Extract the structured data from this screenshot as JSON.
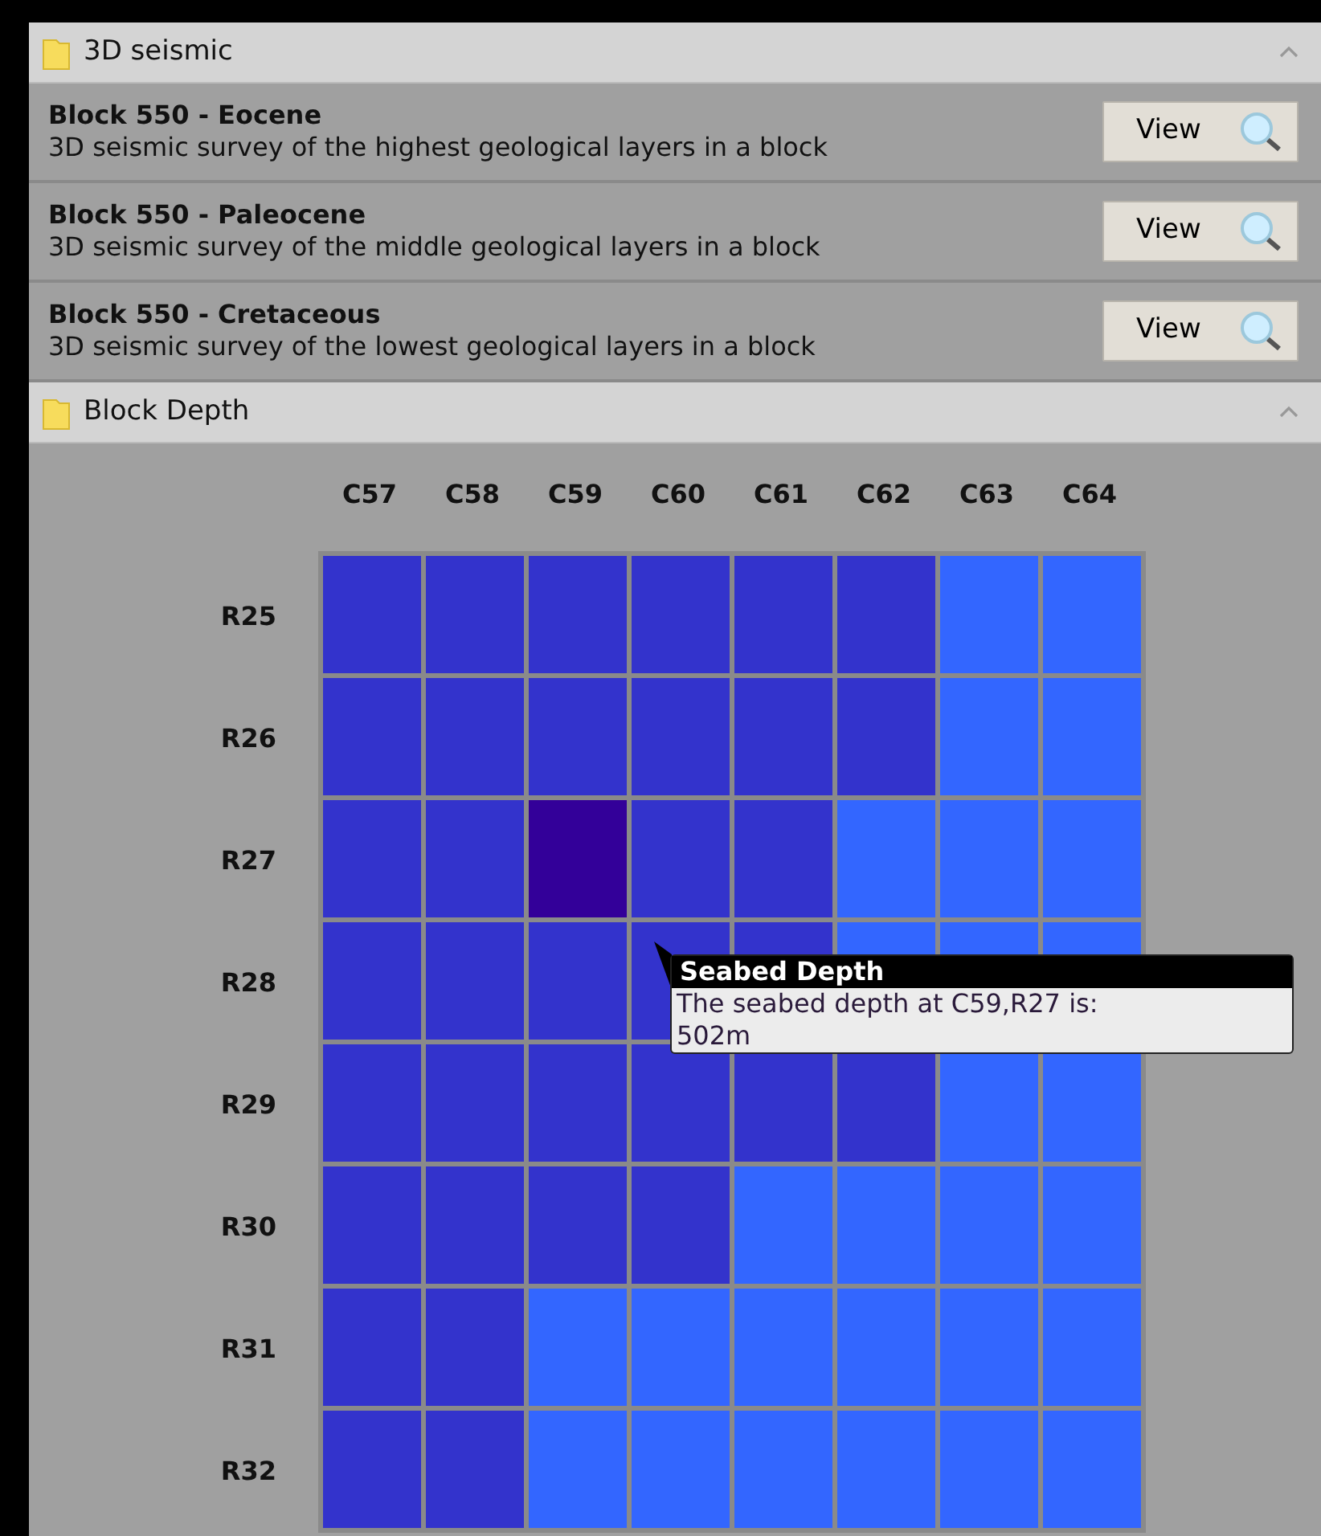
{
  "sections": [
    {
      "title": "3D seismic",
      "expanded": true,
      "items": [
        {
          "title": "Block 550 - Eocene",
          "description": "3D seismic survey of the highest geological layers in a block",
          "button": "View"
        },
        {
          "title": "Block 550 - Paleocene",
          "description": "3D seismic survey of the middle geological layers in a block",
          "button": "View"
        },
        {
          "title": "Block 550 - Cretaceous",
          "description": "3D seismic survey of the lowest geological layers in a block",
          "button": "View"
        }
      ]
    },
    {
      "title": "Block Depth",
      "expanded": true,
      "heatmap": {
        "columns": [
          "C57",
          "C58",
          "C59",
          "C60",
          "C61",
          "C62",
          "C63",
          "C64"
        ],
        "rows": [
          {
            "label": "R25",
            "cells": [
              {
                "color": "#3333cc"
              },
              {
                "color": "#3333cc"
              },
              {
                "color": "#3333cc"
              },
              {
                "color": "#3333cc"
              },
              {
                "color": "#3333cc"
              },
              {
                "color": "#3333cc"
              },
              {
                "color": "#3366ff"
              },
              {
                "color": "#3366ff"
              }
            ]
          },
          {
            "label": "R26",
            "cells": [
              {
                "color": "#3333cc"
              },
              {
                "color": "#3333cc"
              },
              {
                "color": "#3333cc"
              },
              {
                "color": "#3333cc"
              },
              {
                "color": "#3333cc"
              },
              {
                "color": "#3333cc"
              },
              {
                "color": "#3366ff"
              },
              {
                "color": "#3366ff"
              }
            ]
          },
          {
            "label": "R27",
            "cells": [
              {
                "color": "#3333cc"
              },
              {
                "color": "#3333cc"
              },
              {
                "color": "#330099"
              },
              {
                "color": "#3333cc"
              },
              {
                "color": "#3333cc"
              },
              {
                "color": "#3366ff"
              },
              {
                "color": "#3366ff"
              },
              {
                "color": "#3366ff"
              }
            ]
          },
          {
            "label": "R28",
            "cells": [
              {
                "color": "#3333cc"
              },
              {
                "color": "#3333cc"
              },
              {
                "color": "#3333cc"
              },
              {
                "color": "#3333cc"
              },
              {
                "color": "#3333cc"
              },
              {
                "color": "#3366ff"
              },
              {
                "color": "#3366ff"
              },
              {
                "color": "#3366ff"
              }
            ]
          },
          {
            "label": "R29",
            "cells": [
              {
                "color": "#3333cc"
              },
              {
                "color": "#3333cc"
              },
              {
                "color": "#3333cc"
              },
              {
                "color": "#3333cc"
              },
              {
                "color": "#3333cc"
              },
              {
                "color": "#3333cc"
              },
              {
                "color": "#3366ff"
              },
              {
                "color": "#3366ff"
              }
            ]
          },
          {
            "label": "R30",
            "cells": [
              {
                "color": "#3333cc"
              },
              {
                "color": "#3333cc"
              },
              {
                "color": "#3333cc"
              },
              {
                "color": "#3333cc"
              },
              {
                "color": "#3366ff"
              },
              {
                "color": "#3366ff"
              },
              {
                "color": "#3366ff"
              },
              {
                "color": "#3366ff"
              }
            ]
          },
          {
            "label": "R31",
            "cells": [
              {
                "color": "#3333cc"
              },
              {
                "color": "#3333cc"
              },
              {
                "color": "#3366ff"
              },
              {
                "color": "#3366ff"
              },
              {
                "color": "#3366ff"
              },
              {
                "color": "#3366ff"
              },
              {
                "color": "#3366ff"
              },
              {
                "color": "#3366ff"
              }
            ]
          },
          {
            "label": "R32",
            "cells": [
              {
                "color": "#3333cc"
              },
              {
                "color": "#3333cc"
              },
              {
                "color": "#3366ff"
              },
              {
                "color": "#3366ff"
              },
              {
                "color": "#3366ff"
              },
              {
                "color": "#3366ff"
              },
              {
                "color": "#3366ff"
              },
              {
                "color": "#3366ff"
              }
            ]
          }
        ],
        "tooltip": {
          "title": "Seabed Depth",
          "text": "The seabed depth at C59,R27 is: 502m"
        }
      }
    }
  ]
}
